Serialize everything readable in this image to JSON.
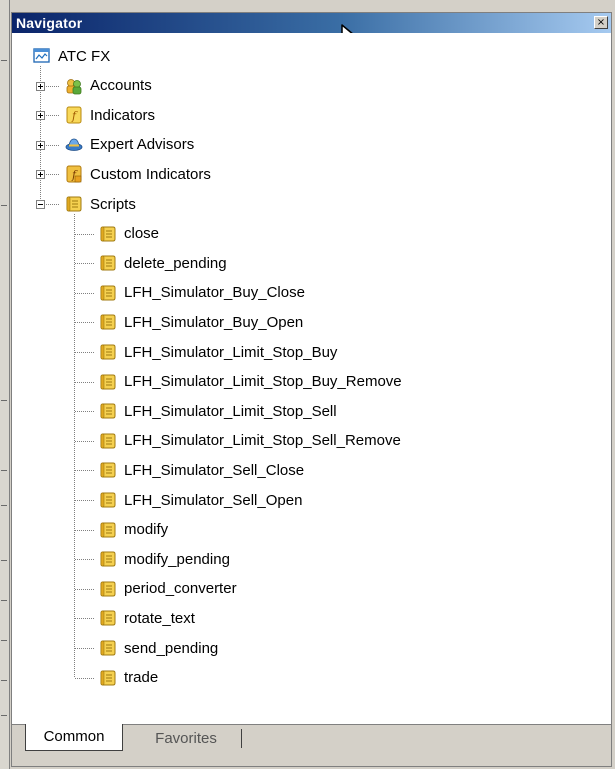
{
  "window": {
    "title": "Navigator",
    "close_label": "×"
  },
  "tree": {
    "root": {
      "label": "ATC FX",
      "icon": "terminal-icon"
    },
    "groups": [
      {
        "label": "Accounts",
        "icon": "accounts-icon",
        "expanded": false
      },
      {
        "label": "Indicators",
        "icon": "indicator-icon",
        "expanded": false
      },
      {
        "label": "Expert Advisors",
        "icon": "expert-advisor-icon",
        "expanded": false
      },
      {
        "label": "Custom Indicators",
        "icon": "custom-indicator-icon",
        "expanded": false
      },
      {
        "label": "Scripts",
        "icon": "script-icon",
        "expanded": true
      }
    ],
    "scripts": [
      "close",
      "delete_pending",
      "LFH_Simulator_Buy_Close",
      "LFH_Simulator_Buy_Open",
      "LFH_Simulator_Limit_Stop_Buy",
      "LFH_Simulator_Limit_Stop_Buy_Remove",
      "LFH_Simulator_Limit_Stop_Sell",
      "LFH_Simulator_Limit_Stop_Sell_Remove",
      "LFH_Simulator_Sell_Close",
      "LFH_Simulator_Sell_Open",
      "modify",
      "modify_pending",
      "period_converter",
      "rotate_text",
      "send_pending",
      "trade"
    ]
  },
  "tabs": {
    "common": "Common",
    "favorites": "Favorites",
    "active": "Common"
  },
  "colors": {
    "title_gradient_start": "#0a246a",
    "title_gradient_end": "#a6caf0",
    "script_icon": "#e0b020"
  }
}
